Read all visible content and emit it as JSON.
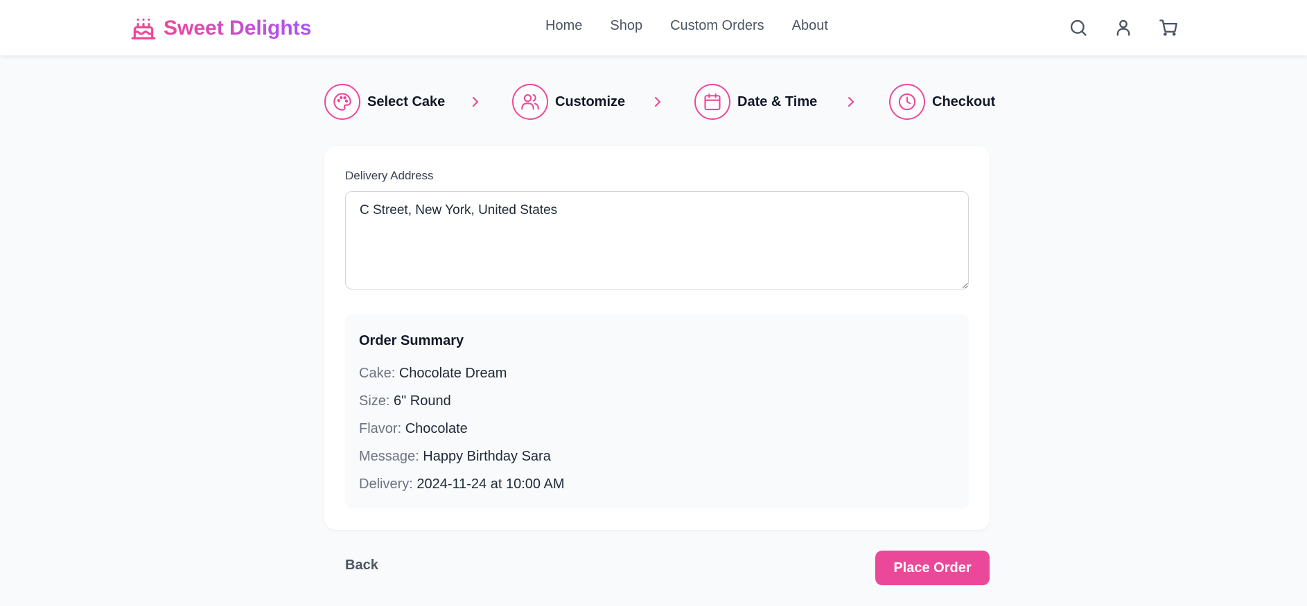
{
  "brand": {
    "name": "Sweet Delights",
    "icon": "cake-icon",
    "gradient_from": "#ec4899",
    "gradient_to": "#a855f7"
  },
  "nav": {
    "items": [
      {
        "label": "Home"
      },
      {
        "label": "Shop"
      },
      {
        "label": "Custom Orders"
      },
      {
        "label": "About"
      }
    ]
  },
  "header_icons": [
    "search-icon",
    "user-icon",
    "cart-icon"
  ],
  "steps": [
    {
      "label": "Select Cake",
      "icon": "palette-icon"
    },
    {
      "label": "Customize",
      "icon": "users-icon"
    },
    {
      "label": "Date & Time",
      "icon": "calendar-icon"
    },
    {
      "label": "Checkout",
      "icon": "clock-icon"
    }
  ],
  "form": {
    "address_label": "Delivery Address",
    "address_value": "C Street, New York, United States"
  },
  "summary": {
    "title": "Order Summary",
    "rows": [
      {
        "key": "Cake:",
        "value": "Chocolate Dream"
      },
      {
        "key": "Size:",
        "value": "6\" Round"
      },
      {
        "key": "Flavor:",
        "value": "Chocolate"
      },
      {
        "key": "Message:",
        "value": "Happy Birthday Sara"
      },
      {
        "key": "Delivery:",
        "value": "2024-11-24 at 10:00 AM"
      }
    ]
  },
  "actions": {
    "back_label": "Back",
    "submit_label": "Place Order"
  },
  "colors": {
    "accent": "#ec4899",
    "background": "#f9fafb",
    "card": "#ffffff"
  }
}
